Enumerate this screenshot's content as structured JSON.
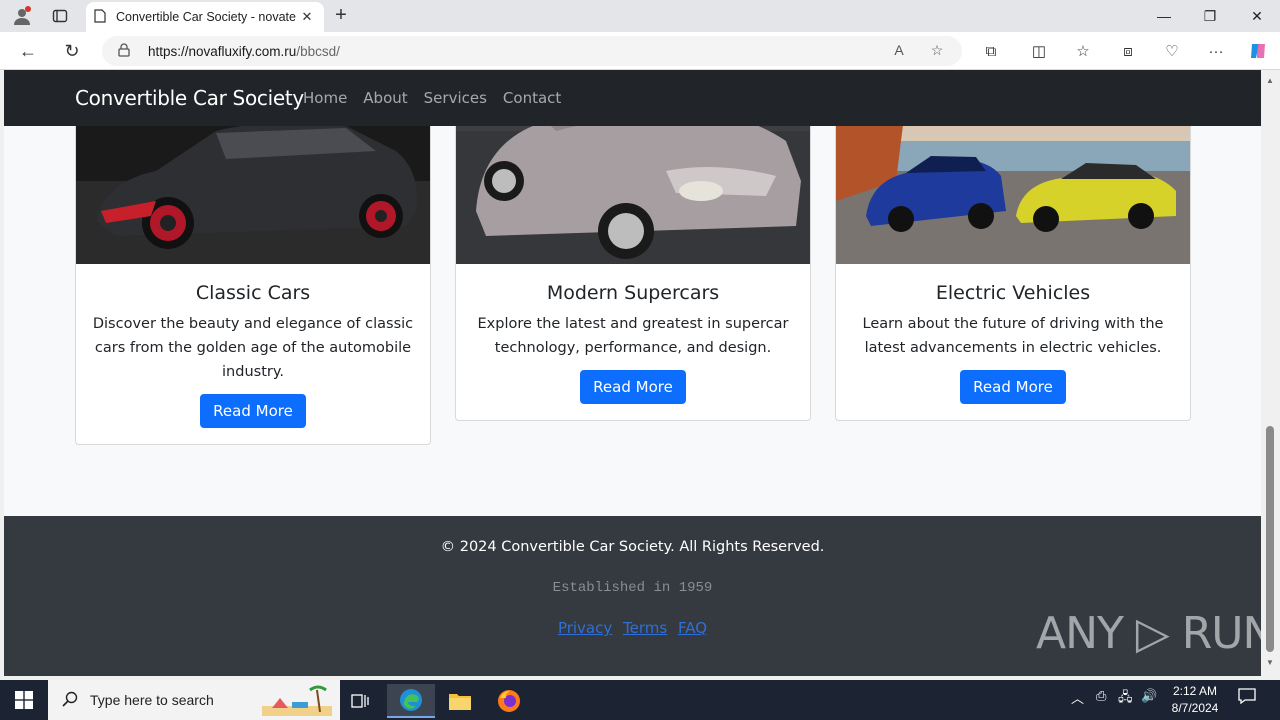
{
  "browser": {
    "tab_title": "Convertible Car Society - novate",
    "url_host": "https://novafluxify.com.ru",
    "url_path": "/bbcsd/"
  },
  "site": {
    "brand": "Convertible Car Society",
    "nav": [
      "Home",
      "About",
      "Services",
      "Contact"
    ],
    "cards": [
      {
        "title": "Classic Cars",
        "text": "Discover the beauty and elegance of classic cars from the golden age of the automobile industry.",
        "button": "Read More"
      },
      {
        "title": "Modern Supercars",
        "text": "Explore the latest and greatest in supercar technology, performance, and design.",
        "button": "Read More"
      },
      {
        "title": "Electric Vehicles",
        "text": "Learn about the future of driving with the latest advancements in electric vehicles.",
        "button": "Read More"
      }
    ],
    "footer": {
      "copyright": "© 2024 Convertible Car Society. All Rights Reserved.",
      "established": "Established in 1959",
      "links": [
        "Privacy",
        "Terms",
        "FAQ"
      ]
    }
  },
  "watermark": "ANY RUN",
  "taskbar": {
    "search_placeholder": "Type here to search",
    "time": "2:12 AM",
    "date": "8/7/2024"
  },
  "colors": {
    "navbar": "#212529",
    "footer": "#343a40",
    "button": "#0d6efd",
    "page_bg": "#f8f9fa"
  }
}
